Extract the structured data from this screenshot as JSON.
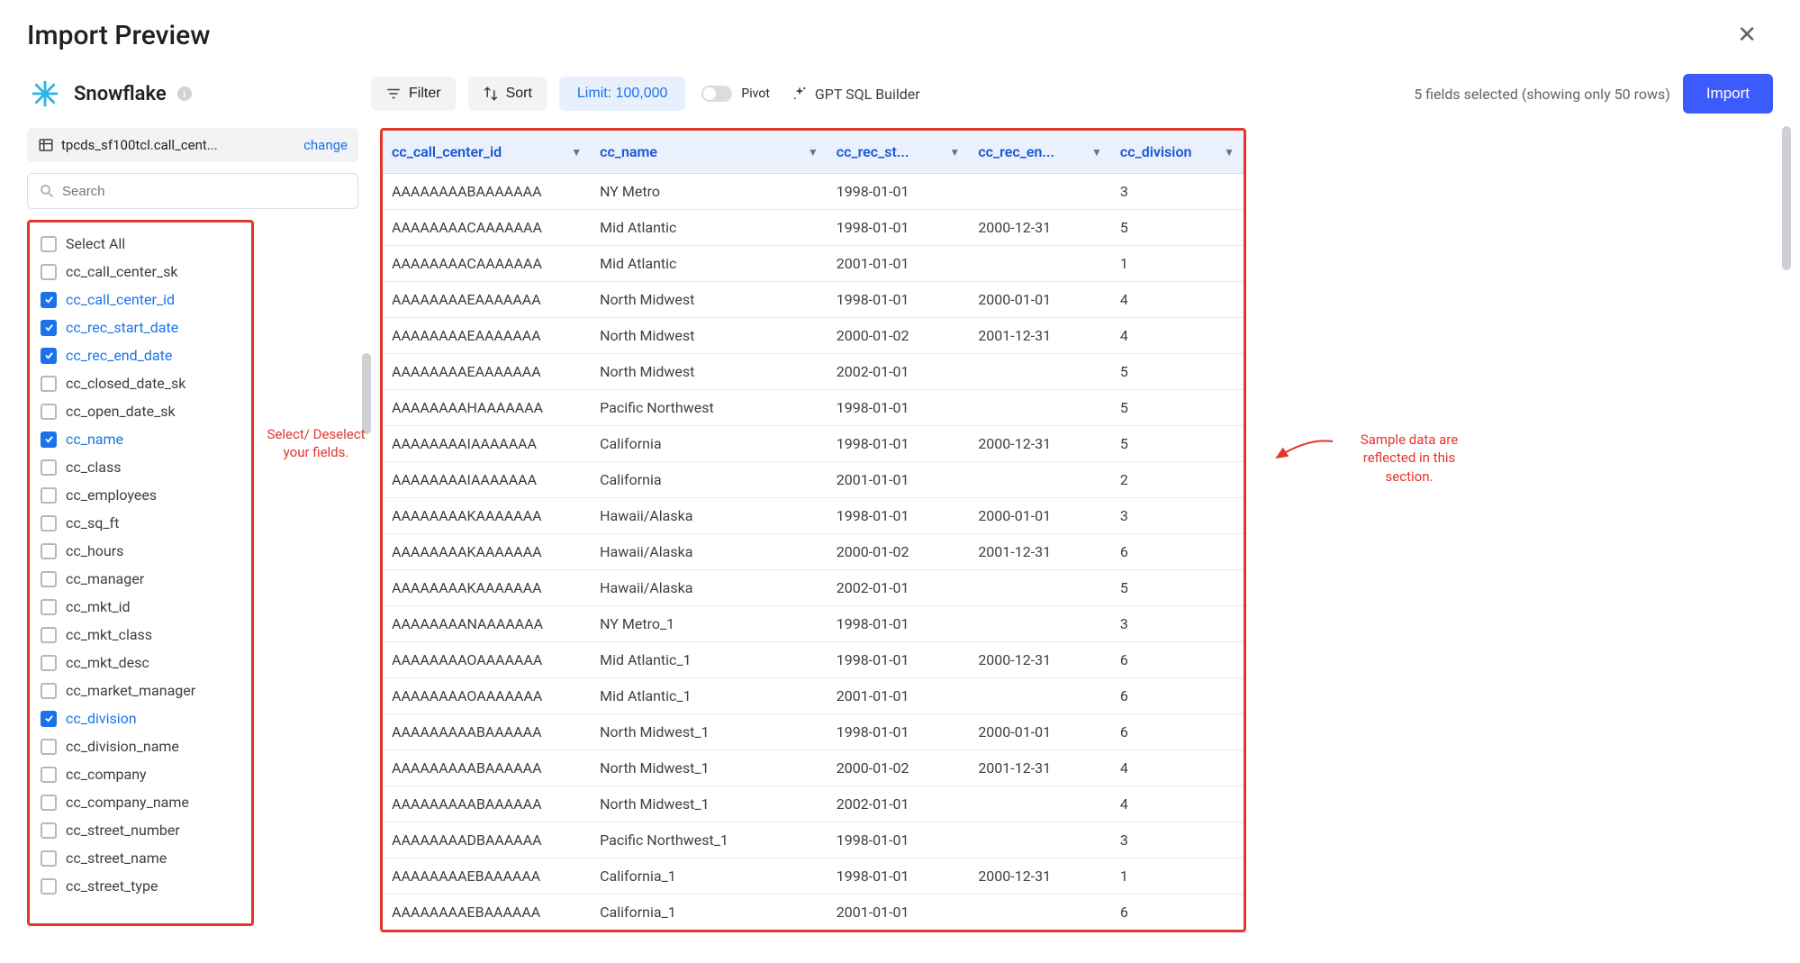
{
  "header": {
    "title": "Import Preview"
  },
  "source": {
    "name": "Snowflake",
    "table_path": "tpcds_sf100tcl.call_cent...",
    "change_label": "change",
    "search_placeholder": "Search"
  },
  "toolbar": {
    "filter_label": "Filter",
    "sort_label": "Sort",
    "limit_label": "Limit: 100,000",
    "pivot_label": "Pivot",
    "gpt_label": "GPT SQL Builder",
    "selected_summary": "5 fields selected (showing only 50 rows)",
    "import_label": "Import"
  },
  "fields": {
    "select_all_label": "Select All",
    "items": [
      {
        "name": "cc_call_center_sk",
        "checked": false
      },
      {
        "name": "cc_call_center_id",
        "checked": true
      },
      {
        "name": "cc_rec_start_date",
        "checked": true
      },
      {
        "name": "cc_rec_end_date",
        "checked": true
      },
      {
        "name": "cc_closed_date_sk",
        "checked": false
      },
      {
        "name": "cc_open_date_sk",
        "checked": false
      },
      {
        "name": "cc_name",
        "checked": true
      },
      {
        "name": "cc_class",
        "checked": false
      },
      {
        "name": "cc_employees",
        "checked": false
      },
      {
        "name": "cc_sq_ft",
        "checked": false
      },
      {
        "name": "cc_hours",
        "checked": false
      },
      {
        "name": "cc_manager",
        "checked": false
      },
      {
        "name": "cc_mkt_id",
        "checked": false
      },
      {
        "name": "cc_mkt_class",
        "checked": false
      },
      {
        "name": "cc_mkt_desc",
        "checked": false
      },
      {
        "name": "cc_market_manager",
        "checked": false
      },
      {
        "name": "cc_division",
        "checked": true
      },
      {
        "name": "cc_division_name",
        "checked": false
      },
      {
        "name": "cc_company",
        "checked": false
      },
      {
        "name": "cc_company_name",
        "checked": false
      },
      {
        "name": "cc_street_number",
        "checked": false
      },
      {
        "name": "cc_street_name",
        "checked": false
      },
      {
        "name": "cc_street_type",
        "checked": false
      }
    ]
  },
  "annotations": {
    "field_selector": "Select/\nDeselect\nyour fields.",
    "sample_data": "Sample data are\nreflected in this\nsection."
  },
  "preview": {
    "columns": [
      {
        "key": "cc_call_center_id",
        "label": "cc_call_center_id",
        "cls": "col-id"
      },
      {
        "key": "cc_name",
        "label": "cc_name",
        "cls": "col-name"
      },
      {
        "key": "cc_rec_start",
        "label": "cc_rec_st...",
        "cls": "col-date"
      },
      {
        "key": "cc_rec_end",
        "label": "cc_rec_en...",
        "cls": "col-date"
      },
      {
        "key": "cc_division",
        "label": "cc_division",
        "cls": "col-div"
      }
    ],
    "rows": [
      {
        "cc_call_center_id": "AAAAAAAABAAAAAAA",
        "cc_name": "NY Metro",
        "cc_rec_start": "1998-01-01",
        "cc_rec_end": "",
        "cc_division": "3"
      },
      {
        "cc_call_center_id": "AAAAAAAACAAAAAAA",
        "cc_name": "Mid Atlantic",
        "cc_rec_start": "1998-01-01",
        "cc_rec_end": "2000-12-31",
        "cc_division": "5"
      },
      {
        "cc_call_center_id": "AAAAAAAACAAAAAAA",
        "cc_name": "Mid Atlantic",
        "cc_rec_start": "2001-01-01",
        "cc_rec_end": "",
        "cc_division": "1"
      },
      {
        "cc_call_center_id": "AAAAAAAAEAAAAAAA",
        "cc_name": "North Midwest",
        "cc_rec_start": "1998-01-01",
        "cc_rec_end": "2000-01-01",
        "cc_division": "4"
      },
      {
        "cc_call_center_id": "AAAAAAAAEAAAAAAA",
        "cc_name": "North Midwest",
        "cc_rec_start": "2000-01-02",
        "cc_rec_end": "2001-12-31",
        "cc_division": "4"
      },
      {
        "cc_call_center_id": "AAAAAAAAEAAAAAAA",
        "cc_name": "North Midwest",
        "cc_rec_start": "2002-01-01",
        "cc_rec_end": "",
        "cc_division": "5"
      },
      {
        "cc_call_center_id": "AAAAAAAAHAAAAAAA",
        "cc_name": "Pacific Northwest",
        "cc_rec_start": "1998-01-01",
        "cc_rec_end": "",
        "cc_division": "5"
      },
      {
        "cc_call_center_id": "AAAAAAAAIAAAAAAA",
        "cc_name": "California",
        "cc_rec_start": "1998-01-01",
        "cc_rec_end": "2000-12-31",
        "cc_division": "5"
      },
      {
        "cc_call_center_id": "AAAAAAAAIAAAAAAA",
        "cc_name": "California",
        "cc_rec_start": "2001-01-01",
        "cc_rec_end": "",
        "cc_division": "2"
      },
      {
        "cc_call_center_id": "AAAAAAAAKAAAAAAA",
        "cc_name": "Hawaii/Alaska",
        "cc_rec_start": "1998-01-01",
        "cc_rec_end": "2000-01-01",
        "cc_division": "3"
      },
      {
        "cc_call_center_id": "AAAAAAAAKAAAAAAA",
        "cc_name": "Hawaii/Alaska",
        "cc_rec_start": "2000-01-02",
        "cc_rec_end": "2001-12-31",
        "cc_division": "6"
      },
      {
        "cc_call_center_id": "AAAAAAAAKAAAAAAA",
        "cc_name": "Hawaii/Alaska",
        "cc_rec_start": "2002-01-01",
        "cc_rec_end": "",
        "cc_division": "5"
      },
      {
        "cc_call_center_id": "AAAAAAAANAAAAAAA",
        "cc_name": "NY Metro_1",
        "cc_rec_start": "1998-01-01",
        "cc_rec_end": "",
        "cc_division": "3"
      },
      {
        "cc_call_center_id": "AAAAAAAAOAAAAAAA",
        "cc_name": "Mid Atlantic_1",
        "cc_rec_start": "1998-01-01",
        "cc_rec_end": "2000-12-31",
        "cc_division": "6"
      },
      {
        "cc_call_center_id": "AAAAAAAAOAAAAAAA",
        "cc_name": "Mid Atlantic_1",
        "cc_rec_start": "2001-01-01",
        "cc_rec_end": "",
        "cc_division": "6"
      },
      {
        "cc_call_center_id": "AAAAAAAAABAAAAAA",
        "cc_name": "North Midwest_1",
        "cc_rec_start": "1998-01-01",
        "cc_rec_end": "2000-01-01",
        "cc_division": "6"
      },
      {
        "cc_call_center_id": "AAAAAAAAABAAAAAA",
        "cc_name": "North Midwest_1",
        "cc_rec_start": "2000-01-02",
        "cc_rec_end": "2001-12-31",
        "cc_division": "4"
      },
      {
        "cc_call_center_id": "AAAAAAAAABAAAAAA",
        "cc_name": "North Midwest_1",
        "cc_rec_start": "2002-01-01",
        "cc_rec_end": "",
        "cc_division": "4"
      },
      {
        "cc_call_center_id": "AAAAAAAADBAAAAAA",
        "cc_name": "Pacific Northwest_1",
        "cc_rec_start": "1998-01-01",
        "cc_rec_end": "",
        "cc_division": "3"
      },
      {
        "cc_call_center_id": "AAAAAAAAEBAAAAAA",
        "cc_name": "California_1",
        "cc_rec_start": "1998-01-01",
        "cc_rec_end": "2000-12-31",
        "cc_division": "1"
      },
      {
        "cc_call_center_id": "AAAAAAAAEBAAAAAA",
        "cc_name": "California_1",
        "cc_rec_start": "2001-01-01",
        "cc_rec_end": "",
        "cc_division": "6"
      }
    ]
  }
}
